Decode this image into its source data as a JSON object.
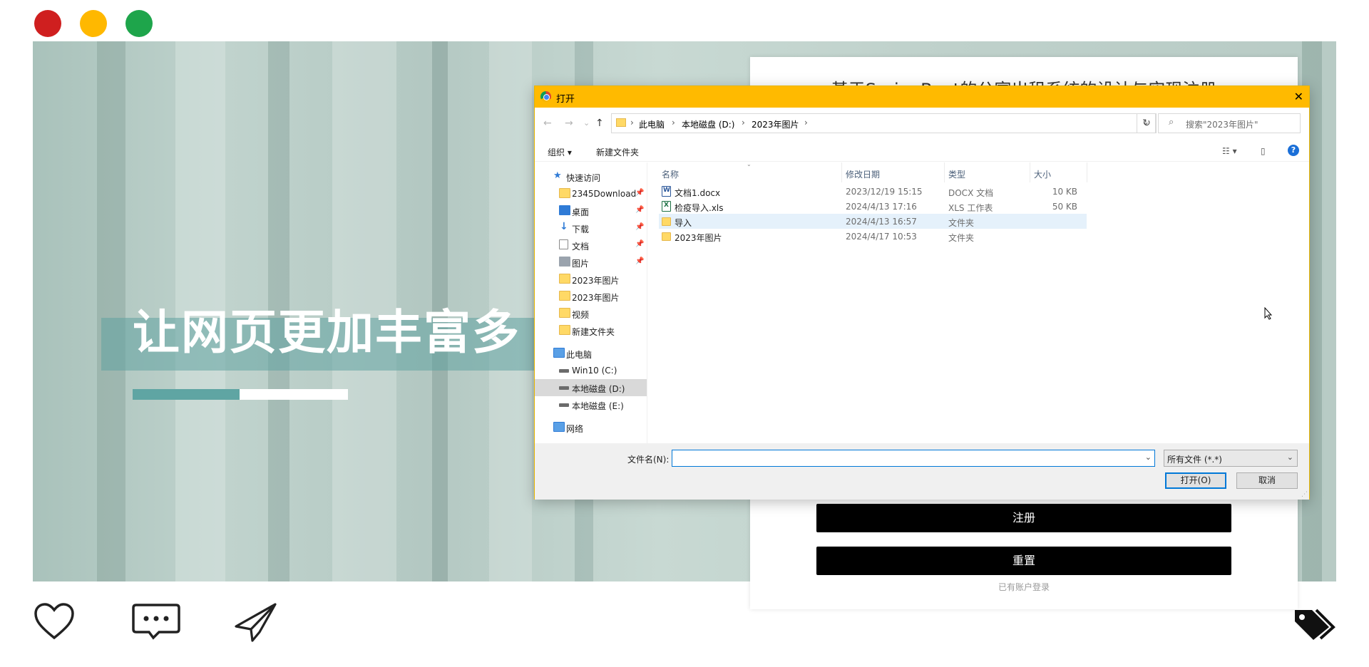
{
  "window_dots": [
    "red-dot",
    "yellow-dot",
    "green-dot"
  ],
  "hero": {
    "title": "让网页更加丰富多"
  },
  "form": {
    "title": "基于SpringBoot的公寓出租系统的设计与实现注册",
    "register_label": "注册",
    "reset_label": "重置",
    "login_link": "已有账户登录"
  },
  "dialog": {
    "title": "打开",
    "close_glyph": "✕",
    "nav": {
      "back": "←",
      "forward": "→",
      "recent": "⌄",
      "up": "↑"
    },
    "breadcrumb": [
      "此电脑",
      "本地磁盘 (D:)",
      "2023年图片"
    ],
    "breadcrumb_sep": "›",
    "address_chevron": "⌄",
    "refresh_glyph": "↻",
    "search_placeholder": "搜索\"2023年图片\"",
    "search_glyph": "⌕",
    "toolbar": {
      "organize": "组织 ▾",
      "new_folder": "新建文件夹",
      "view_glyph": "☷ ▾",
      "preview_glyph": "▯",
      "help_glyph": "?"
    },
    "nav_pane": {
      "quick_access": "快速访问",
      "pin_glyph": "📌",
      "items": [
        {
          "label": "2345Download",
          "pinned": true
        },
        {
          "label": "桌面",
          "pinned": true
        },
        {
          "label": "下载",
          "pinned": true
        },
        {
          "label": "文档",
          "pinned": true
        },
        {
          "label": "图片",
          "pinned": true
        },
        {
          "label": "2023年图片",
          "pinned": false
        },
        {
          "label": "2023年图片",
          "pinned": false
        },
        {
          "label": "视频",
          "pinned": false
        },
        {
          "label": "新建文件夹",
          "pinned": false
        }
      ],
      "this_pc": "此电脑",
      "drives": [
        {
          "label": "Win10 (C:)"
        },
        {
          "label": "本地磁盘 (D:)"
        },
        {
          "label": "本地磁盘 (E:)"
        }
      ],
      "network": "网络"
    },
    "columns": {
      "name": "名称",
      "date": "修改日期",
      "type": "类型",
      "size": "大小",
      "sort_glyph": "⌄"
    },
    "files": [
      {
        "name": "文档1.docx",
        "date": "2023/12/19 15:15",
        "type": "DOCX 文档",
        "size": "10 KB",
        "icon": "docx-icon"
      },
      {
        "name": "检疫导入.xls",
        "date": "2024/4/13 17:16",
        "type": "XLS 工作表",
        "size": "50 KB",
        "icon": "xls-icon"
      },
      {
        "name": "导入",
        "date": "2024/4/13 16:57",
        "type": "文件夹",
        "size": "",
        "icon": "folder-icon"
      },
      {
        "name": "2023年图片",
        "date": "2024/4/17 10:53",
        "type": "文件夹",
        "size": "",
        "icon": "folder-icon"
      }
    ],
    "footer": {
      "filename_label": "文件名(N):",
      "filename_value": "",
      "filetype_value": "所有文件 (*.*)",
      "chevron": "⌄",
      "open_label": "打开(O)",
      "cancel_label": "取消",
      "resize_glyph": "⋰"
    }
  },
  "colors": {
    "dialog_title_bar": "#ffba00",
    "hero_accent": "#5fa5a3",
    "form_button": "#000000"
  }
}
